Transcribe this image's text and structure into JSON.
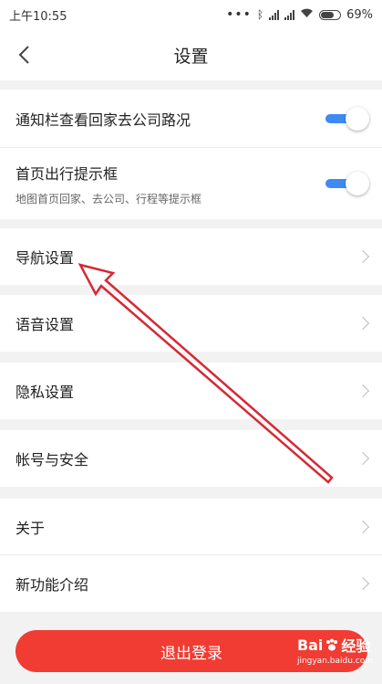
{
  "status_bar": {
    "time": "上午10:55",
    "battery_percent": "69%",
    "battery_level": 0.69
  },
  "header": {
    "title": "设置"
  },
  "settings_top": {
    "notify_traffic": {
      "label": "通知栏查看回家去公司路况",
      "enabled": true
    },
    "home_trip_prompt": {
      "label": "首页出行提示框",
      "sublabel": "地图首页回家、去公司、行程等提示框",
      "enabled": true
    }
  },
  "menu": {
    "navigation": "导航设置",
    "voice": "语音设置",
    "privacy": "隐私设置",
    "account": "帐号与安全",
    "about": "关于",
    "whats_new": "新功能介绍"
  },
  "logout_label": "退出登录",
  "watermark": {
    "brand": "Bai",
    "brand_suffix": "经验",
    "url": "jingyan.baidu.com"
  },
  "colors": {
    "toggle_on": "#3d8bf2",
    "logout_bg": "#f03c33",
    "annotation_arrow": "#d42a35"
  }
}
